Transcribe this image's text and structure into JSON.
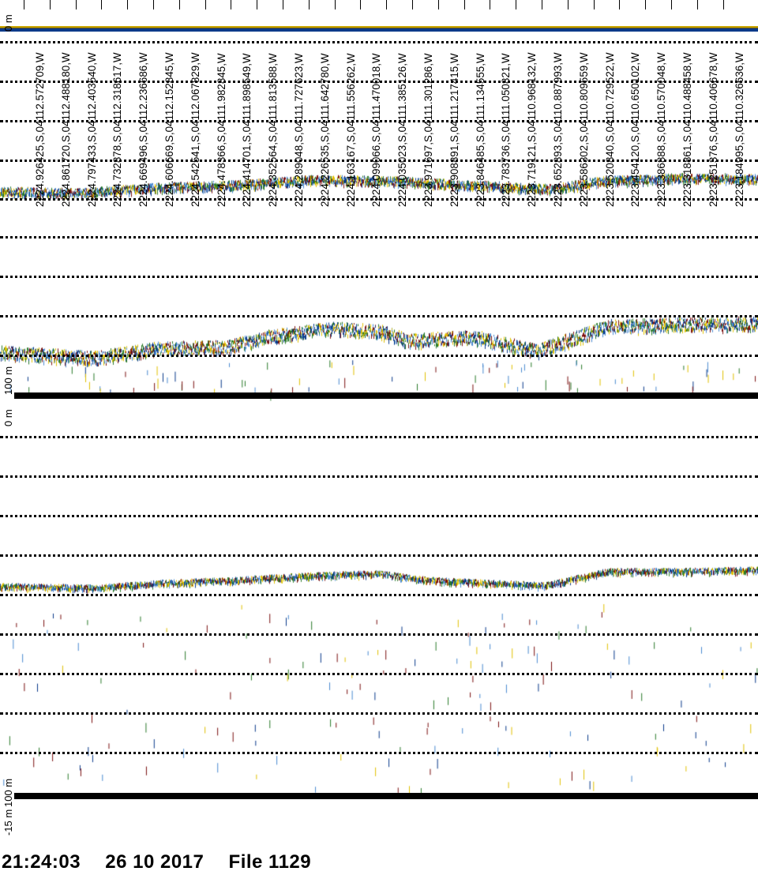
{
  "panels": [
    {
      "top_label": "0 m",
      "bottom_label": "100 m"
    },
    {
      "top_label": "0 m",
      "bottom_label": "100 m",
      "offset_label": "-15 m"
    }
  ],
  "nav_labels": [
    "2224.926425,S,04112.572709,W",
    "2224.861720,S,04112.488180,W",
    "2224.797433,S,04112.403540,W",
    "2224.732878,S,04112.318617,W",
    "2224.669496,S,04112.236686,W",
    "2224.606669,S,04112.152845,W",
    "2224.542541,S,04112.067829,W",
    "2224.478366,S,04111.982845,W",
    "2224.414701,S,04111.898549,W",
    "2224.352564,S,04111.813588,W",
    "2224.289048,S,04111.727623,W",
    "2224.226535,S,04111.642780,W",
    "2224.163167,S,04111.556262,W",
    "2224.099066,S,04111.470018,W",
    "2224.035023,S,04111.385126,W",
    "2223.971697,S,04111.301286,W",
    "2223.908891,S,04111.217415,W",
    "2223.846485,S,04111.134555,W",
    "2223.783736,S,04111.050821,W",
    "2223.719121,S,04110.968132,W",
    "2223.652893,S,04110.887993,W",
    "2223.586302,S,04110.809559,W",
    "2223.520840,S,04110.729522,W",
    "2223.454120,S,04110.650102,W",
    "2223.386888,S,04110.570048,W",
    "2223.318861,S,04110.488458,W",
    "2223.251376,S,04110.406678,W",
    "2223.184995,S,04110.326636,W"
  ],
  "footer": {
    "time": "21:24:03",
    "date": "26 10 2017",
    "file": "File 1129"
  },
  "colors": {
    "echo_strong": "#7a1010",
    "echo_mid": "#e0c000",
    "echo_green": "#2a7a2a",
    "echo_weak": "#0a3a8a",
    "echo_faint": "#4a8ad0"
  }
}
